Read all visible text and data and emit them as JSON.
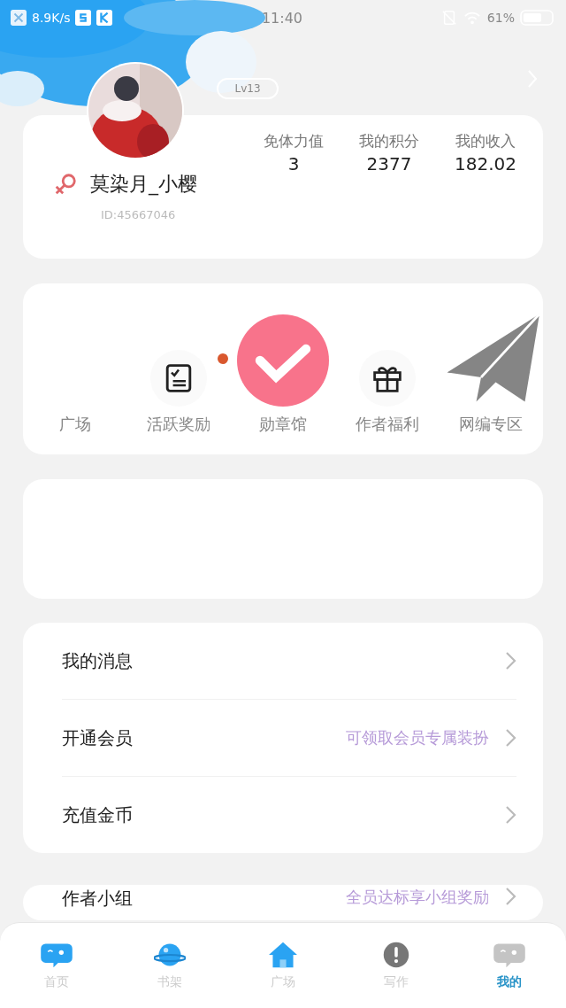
{
  "status_bar": {
    "speed": "8.9K/s",
    "time": "11:40",
    "battery": "61%"
  },
  "profile": {
    "level": "Lv13",
    "name": "莫染月_小樱",
    "id": "ID:45667046",
    "stats": [
      {
        "label": "免体力值",
        "value": "3"
      },
      {
        "label": "我的积分",
        "value": "2377"
      },
      {
        "label": "我的收入",
        "value": "182.02"
      }
    ]
  },
  "shortcuts": [
    {
      "label": "广场",
      "kind": "blank",
      "badge": false
    },
    {
      "label": "活跃奖励",
      "kind": "checklist",
      "badge": true
    },
    {
      "label": "勋章馆",
      "kind": "check",
      "badge": false
    },
    {
      "label": "作者福利",
      "kind": "gift",
      "badge": false
    },
    {
      "label": "网编专区",
      "kind": "plane",
      "badge": false
    }
  ],
  "menu": [
    {
      "label": "我的消息"
    },
    {
      "label": "开通会员",
      "hint": "可领取会员专属装扮"
    },
    {
      "label": "充值金币"
    }
  ],
  "menu_2": [
    {
      "label": "作者小组",
      "hint": "全员达标享小组奖励"
    }
  ],
  "tab_bar": [
    {
      "label": "首页",
      "kind": "chat",
      "selected": false
    },
    {
      "label": "书架",
      "kind": "planet",
      "selected": false
    },
    {
      "label": "广场",
      "kind": "home",
      "selected": false
    },
    {
      "label": "写作",
      "kind": "alert",
      "selected": false
    },
    {
      "label": "我的",
      "kind": "chat",
      "selected": true
    }
  ]
}
